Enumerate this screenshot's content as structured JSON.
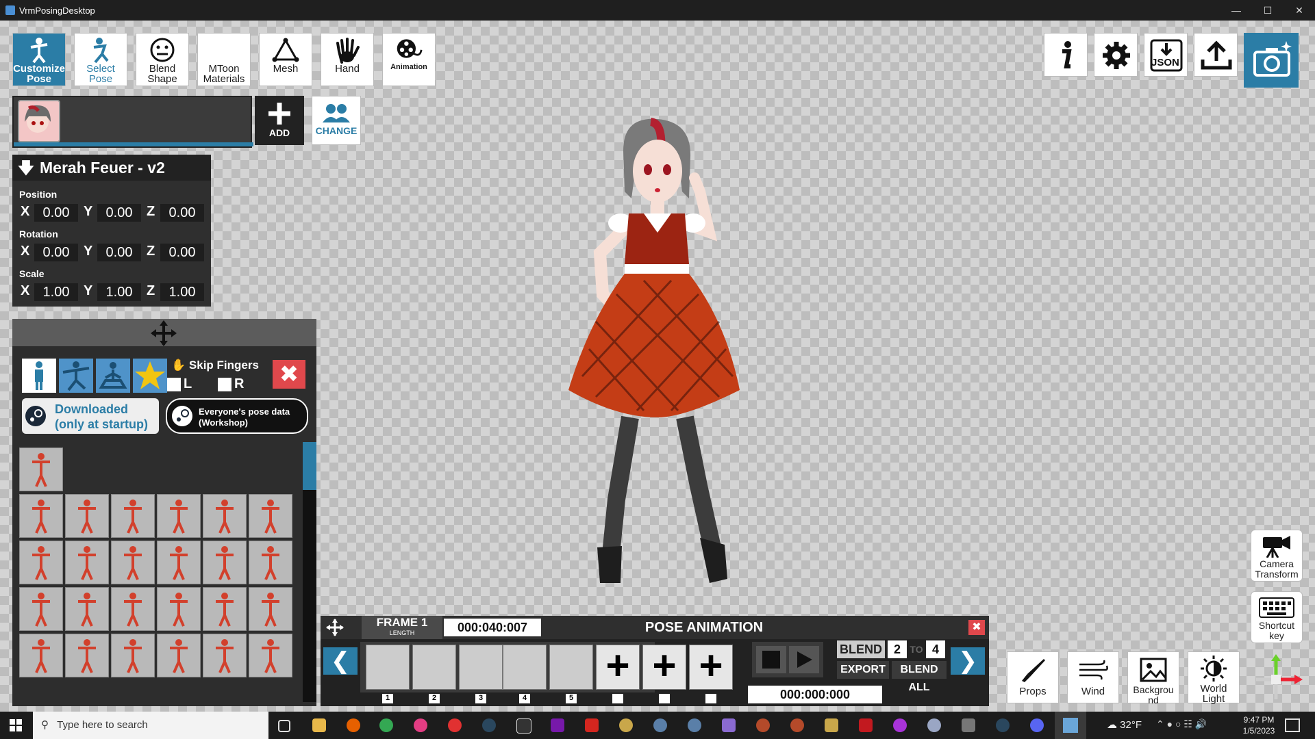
{
  "window": {
    "title": "VrmPosingDesktop"
  },
  "toolbar": {
    "items": [
      {
        "label": "Customize Pose",
        "active": true
      },
      {
        "label": "Select Pose"
      },
      {
        "label": "Blend Shape"
      },
      {
        "label": "MToon Materials"
      },
      {
        "label": "Mesh"
      },
      {
        "label": "Hand"
      },
      {
        "label": "Animation"
      }
    ]
  },
  "right_toolbar": {
    "json_label": "JSON"
  },
  "avatar": {
    "add_label": "ADD",
    "change_label": "CHANGE"
  },
  "transform": {
    "name": "Merah Feuer - v2",
    "position_label": "Position",
    "rotation_label": "Rotation",
    "scale_label": "Scale",
    "position": {
      "x": "0.00",
      "y": "0.00",
      "z": "0.00"
    },
    "rotation": {
      "x": "0.00",
      "y": "0.00",
      "z": "0.00"
    },
    "scale": {
      "x": "1.00",
      "y": "1.00",
      "z": "1.00"
    },
    "axis": {
      "x": "X",
      "y": "Y",
      "z": "Z"
    }
  },
  "pose_panel": {
    "skip_fingers": "Skip Fingers",
    "left": "L",
    "right": "R",
    "downloaded": "Downloaded\n(only at startup)",
    "downloaded_line1": "Downloaded",
    "downloaded_line2": "(only at startup)",
    "workshop_line1": "Everyone's pose data",
    "workshop_line2": "(Workshop)"
  },
  "animation": {
    "frame_label": "FRAME 1",
    "length_label": "LENGTH",
    "length_value": "000:040:007",
    "title": "POSE ANIMATION",
    "blend_label": "BLEND",
    "blend_from": "2",
    "blend_to_label": "TO",
    "blend_to": "4",
    "export_label": "EXPORT",
    "blend_all_label": "BLEND ALL",
    "time": "000:000:000",
    "frames": [
      "1",
      "2",
      "3",
      "4",
      "5"
    ]
  },
  "side_buttons": {
    "camera": "Camera Transform",
    "shortcut": "Shortcut key"
  },
  "bottom_buttons": {
    "props": "Props",
    "wind": "Wind",
    "background": "Background",
    "world_light": "World Light"
  },
  "taskbar": {
    "search_placeholder": "Type here to search",
    "weather": "32°F",
    "time": "9:47 PM",
    "date": "1/5/2023"
  }
}
